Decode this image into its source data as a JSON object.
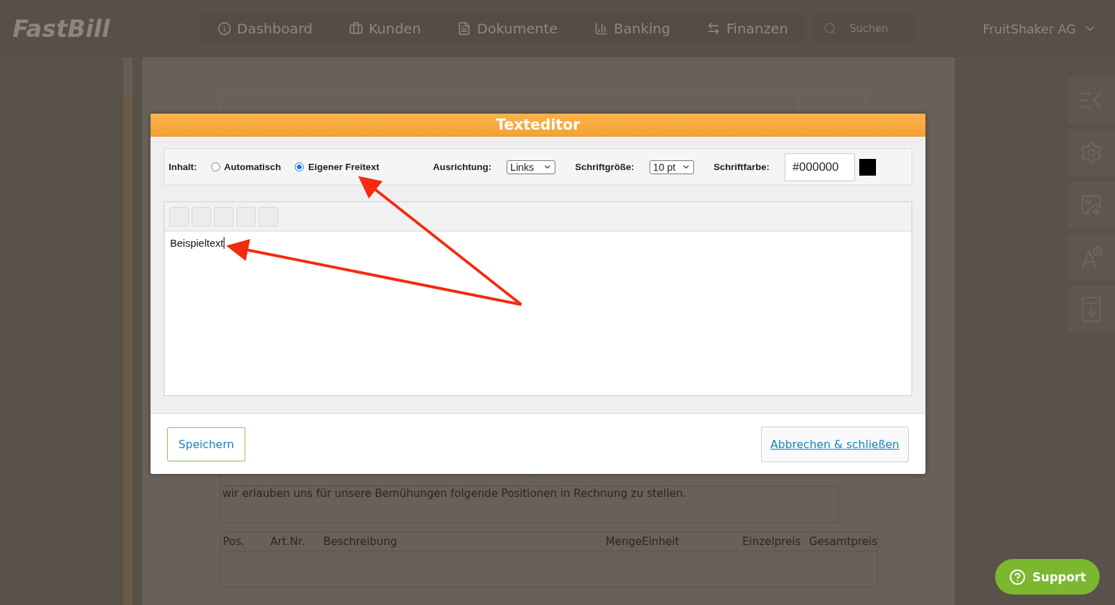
{
  "app_header": {
    "logo": "FastBill",
    "nav": [
      {
        "label": "Dashboard",
        "selected": false
      },
      {
        "label": "Kunden",
        "selected": false
      },
      {
        "label": "Dokumente",
        "selected": false
      },
      {
        "label": "Banking",
        "selected": false
      },
      {
        "label": "Finanzen",
        "selected": false
      }
    ],
    "search": {
      "placeholder": "Suchen"
    },
    "account": "FruitShaker AG"
  },
  "document": {
    "intro_text": "wir erlauben uns für unsere Bemühungen folgende Positionen in Rechnung zu stellen.",
    "table": {
      "columns": [
        "Pos.",
        "Art.Nr.",
        "Beschreibung",
        "Menge",
        "Einheit",
        "Einzelpreis",
        "Gesamtpreis"
      ]
    }
  },
  "dialog": {
    "title": "Texteditor",
    "content": {
      "label": "Inhalt:",
      "options": [
        {
          "label": "Automatisch",
          "selected": false
        },
        {
          "label": "Eigener Freitext",
          "selected": true
        }
      ]
    },
    "alignment": {
      "label": "Ausrichtung:",
      "value": "Links"
    },
    "font_size": {
      "label": "Schriftgröße:",
      "value": "10 pt"
    },
    "font_color": {
      "label": "Schriftfarbe:",
      "value": "#000000",
      "color": "#000000"
    },
    "editor": {
      "text": "Beispieltext"
    },
    "save_button": "Speichern",
    "cancel_link": "Abbrechen & schließen"
  },
  "support_button": "Support"
}
